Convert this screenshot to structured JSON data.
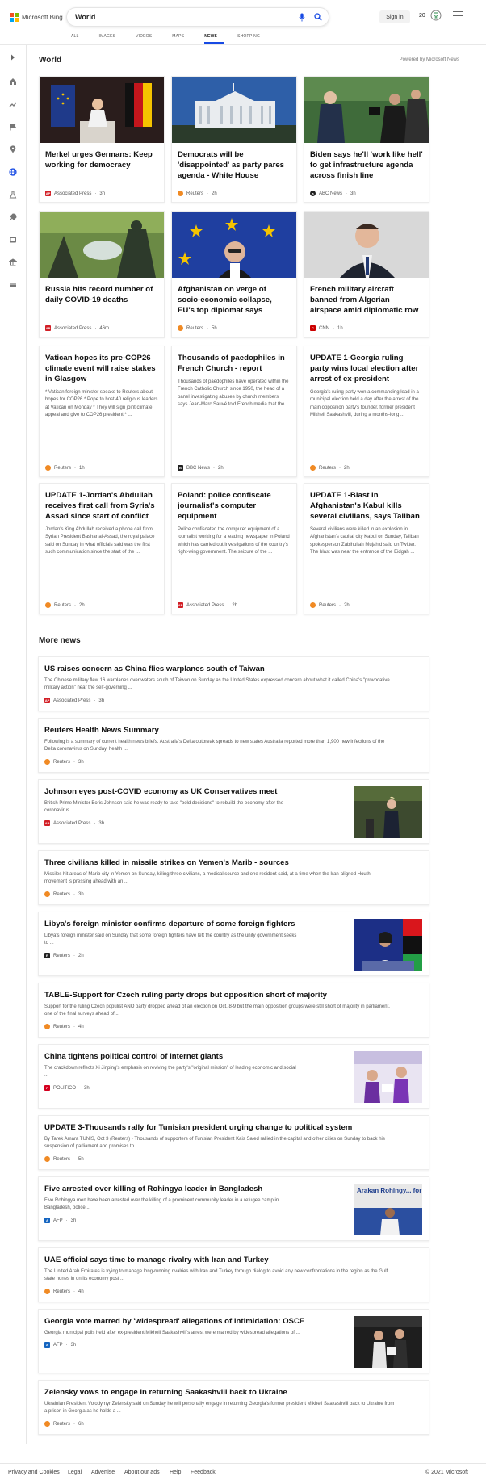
{
  "header": {
    "logo_text": "Microsoft Bing",
    "query": "World",
    "signin_label": "Sign in",
    "rewards_count": "20",
    "tabs": [
      {
        "label": "ALL"
      },
      {
        "label": "IMAGES"
      },
      {
        "label": "VIDEOS"
      },
      {
        "label": "MAPS"
      },
      {
        "label": "NEWS"
      },
      {
        "label": "SHOPPING"
      }
    ]
  },
  "section": {
    "title": "World",
    "powered": "Powered by Microsoft News",
    "more_news": "More news"
  },
  "cards": [
    {
      "title": "Merkel urges Germans: Keep working for democracy",
      "source": "Associated Press",
      "time": "3h"
    },
    {
      "title": "Democrats will be 'disappointed' as party pares agenda - White House",
      "source": "Reuters",
      "time": "2h"
    },
    {
      "title": "Biden says he'll 'work like hell' to get infrastructure agenda across finish line",
      "source": "ABC News",
      "time": "3h"
    },
    {
      "title": "Russia hits record number of daily COVID-19 deaths",
      "source": "Associated Press",
      "time": "46m"
    },
    {
      "title": "Afghanistan on verge of socio-economic collapse, EU's top diplomat says",
      "source": "Reuters",
      "time": "5h"
    },
    {
      "title": "French military aircraft banned from Algerian airspace amid diplomatic row",
      "source": "CNN",
      "time": "1h"
    },
    {
      "title": "Vatican hopes its pre-COP26 climate event will raise stakes in Glasgow",
      "desc": "* Vatican foreign minister speaks to Reuters about hopes for COP26 * Pope to host 40 religious leaders at Vatican on Monday * They will sign joint climate appeal and give to COP26 president * ...",
      "source": "Reuters",
      "time": "1h"
    },
    {
      "title": "Thousands of paedophiles in French Church - report",
      "desc": "Thousands of paedophiles have operated within the French Catholic Church since 1950, the head of a panel investigating abuses by church members says.Jean-Marc Sauvé told French media that the ...",
      "source": "BBC News",
      "time": "2h"
    },
    {
      "title": "UPDATE 1-Georgia ruling party wins local election after arrest of ex-president",
      "desc": "Georgia's ruling party won a commanding lead in a municipal election held a day after the arrest of the main opposition party's founder, former president Mikheil Saakashvili, during a months-long ...",
      "source": "Reuters",
      "time": "2h"
    },
    {
      "title": "UPDATE 1-Jordan's Abdullah receives first call from Syria's Assad since start of conflict",
      "desc": "Jordan's King Abdullah received a phone call from Syrian President Bashar al-Assad, the royal palace said on Sunday in what officials said was the first such communication since the start of the ...",
      "source": "Reuters",
      "time": "2h"
    },
    {
      "title": "Poland: police confiscate journalist's computer equipment",
      "desc": "Police confiscated the computer equipment of a journalist working for a leading newspaper in Poland which has carried out investigations of the country's right-wing government. The seizure of the ...",
      "source": "Associated Press",
      "time": "2h"
    },
    {
      "title": "UPDATE 1-Blast in Afghanistan's Kabul kills several civilians, says Taliban",
      "desc": "Several civilians were killed in an explosion in Afghanistan's capital city Kabul on Sunday, Taliban spokesperson Zabihullah Mujahid said on Twitter. The blast was near the entrance of the Eidgah ...",
      "source": "Reuters",
      "time": "2h"
    }
  ],
  "more": [
    {
      "title": "US raises concern as China flies warplanes south of Taiwan",
      "desc1": "The Chinese military flew 16 warplanes over waters south of Taiwan on Sunday as the United States expressed concern about what it called China's \"provocative",
      "desc2": "military action\" near the self-governing ...",
      "source": "Associated Press",
      "time": "3h"
    },
    {
      "title": "Reuters Health News Summary",
      "desc1": "Following is a summary of current health news briefs. Australia's Delta outbreak spreads to new states Australia reported more than 1,900 new infections of the",
      "desc2": "Delta coronavirus on Sunday, health ...",
      "source": "Reuters",
      "time": "3h"
    },
    {
      "title": "Johnson eyes post-COVID economy as UK Conservatives meet",
      "desc1": "British Prime Minister Boris Johnson said he was ready to take \"bold decisions\" to rebuild the economy after the",
      "desc2": "coronavirus ...",
      "source": "Associated Press",
      "time": "3h"
    },
    {
      "title": "Three civilians killed in missile strikes on Yemen's Marib - sources",
      "desc1": "Missiles hit areas of Marib city in Yemen on Sunday, killing three civilians, a medical source and one resident said, at a time when the Iran-aligned Houthi",
      "desc2": "movement is pressing ahead with an ...",
      "source": "Reuters",
      "time": "3h"
    },
    {
      "title": "Libya's foreign minister confirms departure of some foreign fighters",
      "desc1": "Libya's foreign minister said on Sunday that some foreign fighters have left the country as the unity government seeks",
      "desc2": "to ...",
      "source": "Reuters",
      "time": "2h"
    },
    {
      "title": "TABLE-Support for Czech ruling party drops but opposition short of majority",
      "desc1": "Support for the ruling Czech populist ANO party dropped ahead of an election on Oct. 8-9 but the main opposition groups were still short of majority in parliament,",
      "desc2": "one of the final surveys ahead of ...",
      "source": "Reuters",
      "time": "4h"
    },
    {
      "title": "China tightens political control of internet giants",
      "desc1": "The crackdown reflects Xi Jinping's emphasis on reviving the party's \"original mission\" of leading economic and social",
      "desc2": "...",
      "source": "POLITICO",
      "time": "3h"
    },
    {
      "title": "UPDATE 3-Thousands rally for Tunisian president urging change to political system",
      "desc1": "By Tarek Amara TUNIS, Oct 3 (Reuters) - Thousands of supporters of Tunisian President Kais Saied rallied in the capital and other cities on Sunday to back his",
      "desc2": "suspension of parliament and promises to ...",
      "source": "Reuters",
      "time": "5h"
    },
    {
      "title": "Five arrested over killing of Rohingya leader in Bangladesh",
      "desc1": "Five Rohingya men have been arrested over the killing of a prominent community leader in a refugee camp in",
      "desc2": "Bangladesh, police ...",
      "source": "AFP",
      "time": "3h",
      "thumb_text": "Arakan Rohingy... for Peace & Hum..."
    },
    {
      "title": "UAE official says time to manage rivalry with Iran and Turkey",
      "desc1": "The United Arab Emirates is trying to manage long-running rivalries with Iran and Turkey through dialog to avoid any new confrontations in the region as the Gulf",
      "desc2": "state hones in on its economy post ...",
      "source": "Reuters",
      "time": "4h"
    },
    {
      "title": "Georgia vote marred by 'widespread' allegations of intimidation: OSCE",
      "desc1": "Georgia municipal polls held after ex-president Mikheil Saakashvili's arrest were marred by widespread allegations of ...",
      "desc2": "",
      "source": "AFP",
      "time": "3h"
    },
    {
      "title": "Zelensky vows to engage in returning Saakashvili back to Ukraine",
      "desc1": "Ukrainian President Volodymyr Zelensky said on Sunday he will personally engage in returning Georgia's former president Mikheil Saakashvili back to Ukraine from",
      "desc2": "a prison in Georgia as he holds a ...",
      "source": "Reuters",
      "time": "6h"
    }
  ],
  "footer": {
    "links": [
      "Privacy and Cookies",
      "Legal",
      "Advertise",
      "About our ads",
      "Help",
      "Feedback"
    ],
    "copyright": "© 2021 Microsoft"
  },
  "colors": {
    "accent": "#174ae4",
    "reuters": "#f08a24",
    "ap": "#d21f26",
    "cnn": "#cc0000",
    "politico": "#d4001f",
    "afp": "#1565c0"
  }
}
